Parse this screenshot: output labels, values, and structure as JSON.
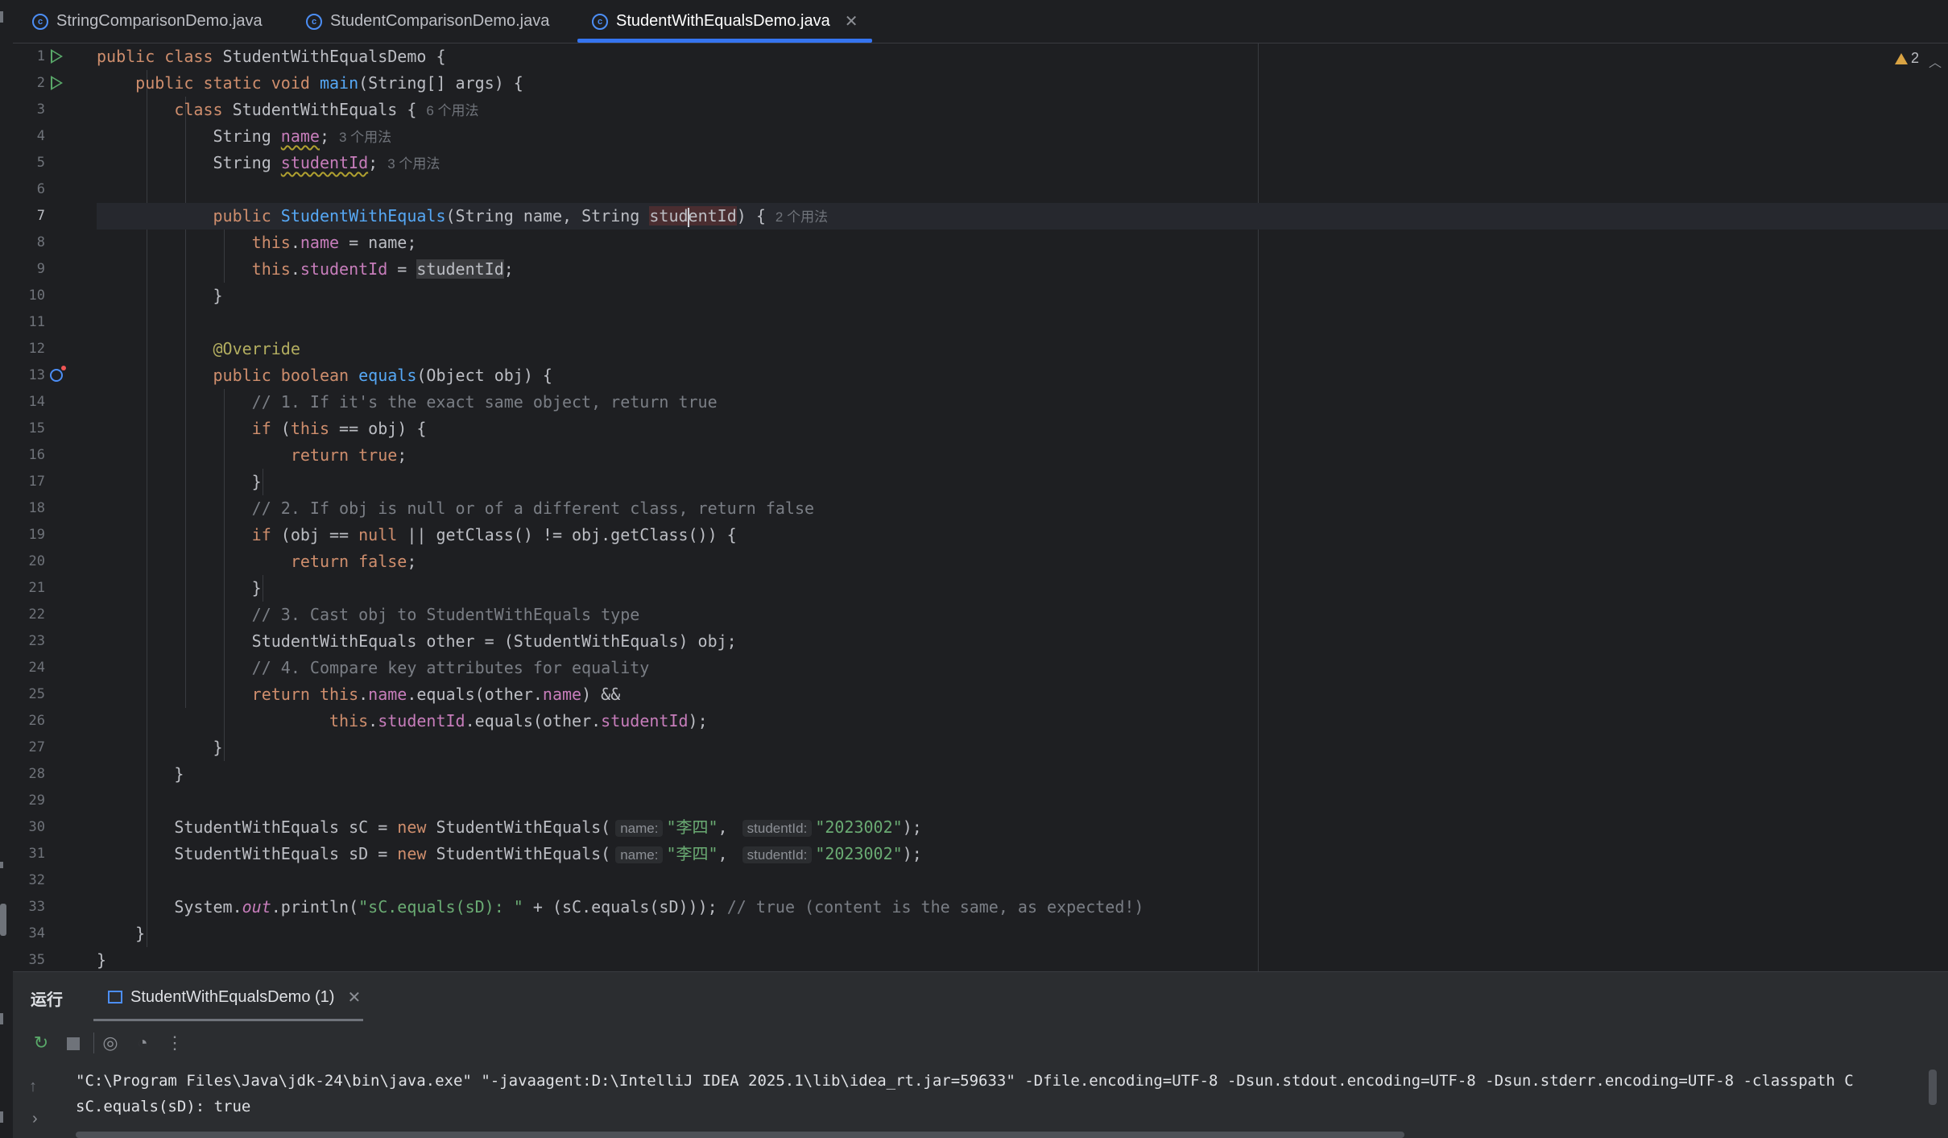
{
  "tabs": [
    {
      "label": "StringComparisonDemo.java"
    },
    {
      "label": "StudentComparisonDemo.java"
    },
    {
      "label": "StudentWithEqualsDemo.java"
    }
  ],
  "editor": {
    "warnings_count": "2",
    "line_numbers": [
      "1",
      "2",
      "3",
      "4",
      "5",
      "6",
      "7",
      "8",
      "9",
      "10",
      "11",
      "12",
      "13",
      "14",
      "15",
      "16",
      "17",
      "18",
      "19",
      "20",
      "21",
      "22",
      "23",
      "24",
      "25",
      "26",
      "27",
      "28",
      "29",
      "30",
      "31",
      "32",
      "33",
      "34",
      "35"
    ],
    "hints": {
      "usages6": "6 个用法",
      "usages3a": "3 个用法",
      "usages3b": "3 个用法",
      "usages2": "2 个用法",
      "param_name": "name:",
      "param_studentId": "studentId:"
    },
    "comments": {
      "c1": "// 1. If it's the exact same object, return true",
      "c2": "// 2. If obj is null or of a different class, return false",
      "c3": "// 3. Cast obj to StudentWithEquals type",
      "c4": "// 4. Compare key attributes for equality",
      "c5": "// true (content is the same, as expected!)"
    },
    "strings": {
      "s_name": "\"李四\"",
      "s_id": "\"2023002\"",
      "s_print": "\"sC.equals(sD): \""
    }
  },
  "run_panel": {
    "title": "运行",
    "tab_label": "StudentWithEqualsDemo (1)",
    "console_lines": [
      "\"C:\\Program Files\\Java\\jdk-24\\bin\\java.exe\" \"-javaagent:D:\\IntelliJ IDEA 2025.1\\lib\\idea_rt.jar=59633\" -Dfile.encoding=UTF-8 -Dsun.stdout.encoding=UTF-8 -Dsun.stderr.encoding=UTF-8 -classpath C",
      "sC.equals(sD): true"
    ]
  }
}
